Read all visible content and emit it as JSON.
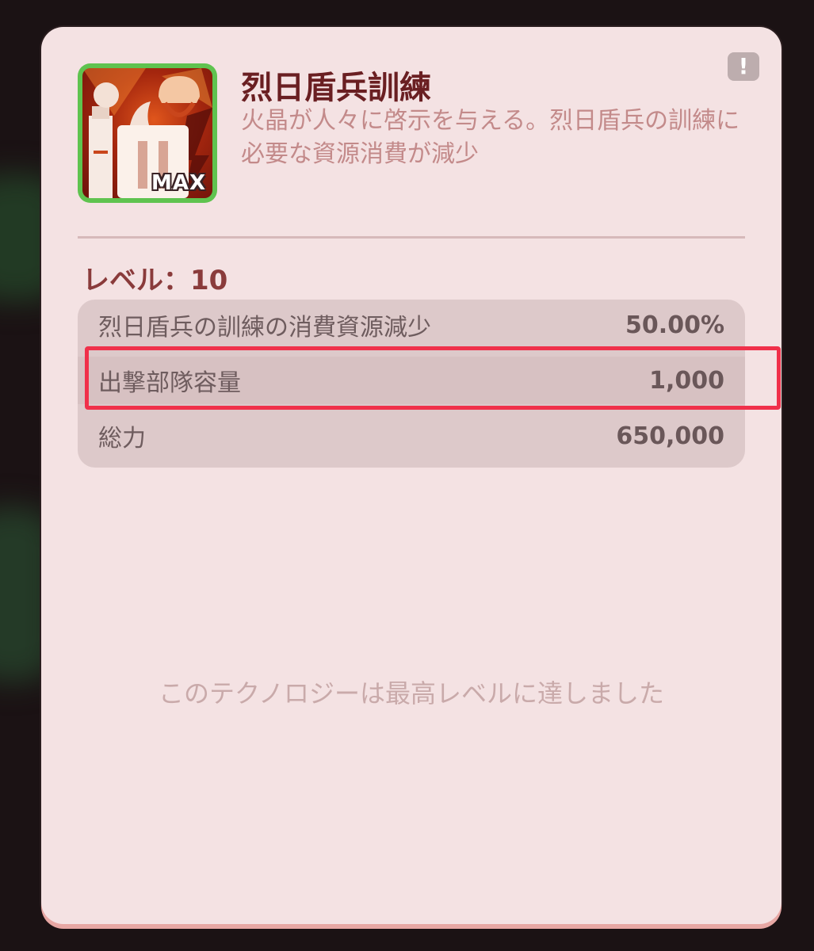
{
  "card": {
    "title": "烈日盾兵訓練",
    "description": "火晶が人々に啓示を与える。烈日盾兵の訓練に必要な資源消費が減少",
    "icon_badge": "MAX",
    "alert_symbol": "!",
    "level_label": "レベル：",
    "level_value": "10",
    "stats": [
      {
        "label": "烈日盾兵の訓練の消費資源減少",
        "value": "50.00%"
      },
      {
        "label": "出撃部隊容量",
        "value": "1,000"
      },
      {
        "label": "総力",
        "value": "650,000"
      }
    ],
    "max_message": "このテクノロジーは最高レベルに達しました"
  },
  "colors": {
    "panel_bg": "#f4e2e3",
    "title": "#6a1f22",
    "highlight_box": "#f0304a",
    "icon_frame": "#5fc34f"
  },
  "icons": {
    "tech_icon": "shield-soldier-icon",
    "alert_icon": "exclamation-icon"
  }
}
